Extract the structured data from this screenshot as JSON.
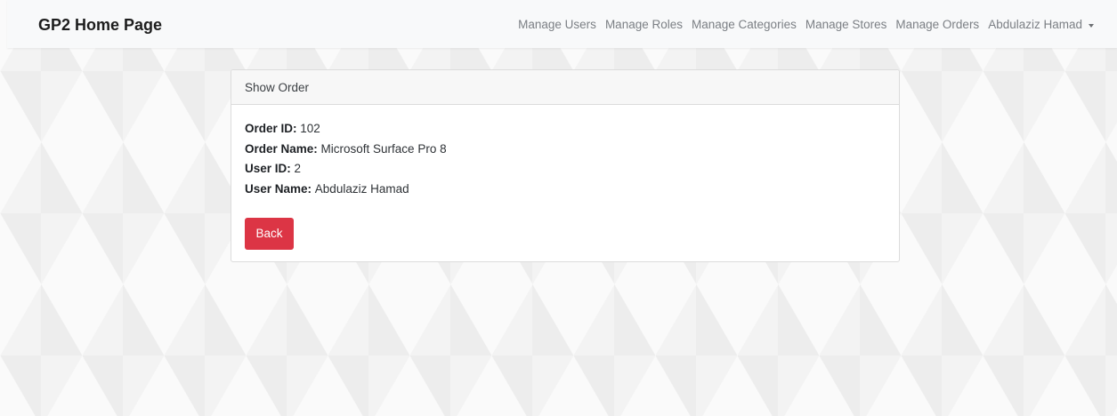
{
  "navbar": {
    "brand": "GP2 Home Page",
    "links": [
      {
        "label": "Manage Users"
      },
      {
        "label": "Manage Roles"
      },
      {
        "label": "Manage Categories"
      },
      {
        "label": "Manage Stores"
      },
      {
        "label": "Manage Orders"
      }
    ],
    "user_menu": {
      "label": "Abdulaziz Hamad",
      "icon": "caret-down-icon"
    }
  },
  "card": {
    "header": "Show Order",
    "fields": [
      {
        "label": "Order ID:",
        "value": "102"
      },
      {
        "label": "Order Name:",
        "value": "Microsoft Surface Pro 8"
      },
      {
        "label": "User ID:",
        "value": "2"
      },
      {
        "label": "User Name:",
        "value": "Abdulaziz Hamad"
      }
    ],
    "back_button": "Back"
  },
  "colors": {
    "danger": "#dc3545",
    "navbar_bg": "#f8f9fa",
    "link": "#7b7f84"
  }
}
